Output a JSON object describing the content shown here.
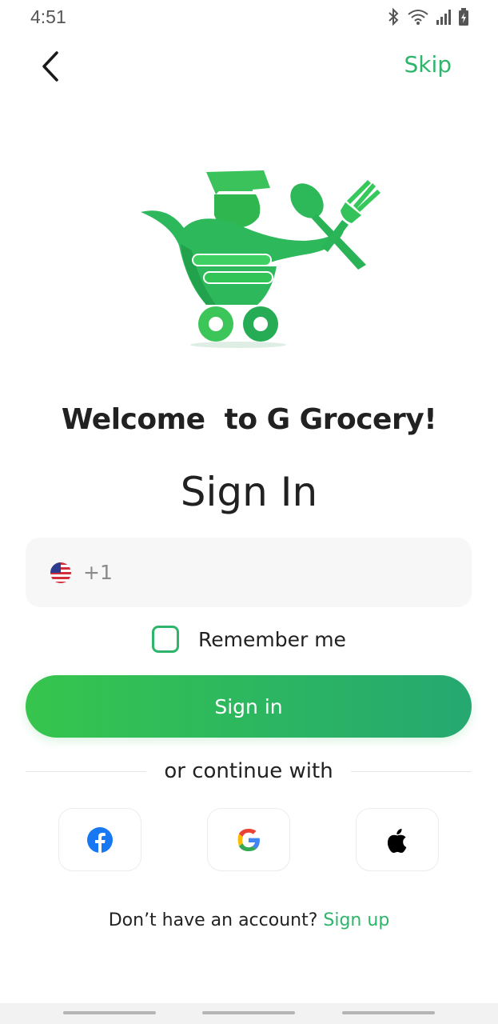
{
  "status_bar": {
    "time": "4:51",
    "icons": [
      "bluetooth-icon",
      "wifi-icon",
      "signal-icon",
      "battery-charging-icon"
    ]
  },
  "header": {
    "back_icon": "chevron-left-icon",
    "skip_label": "Skip"
  },
  "logo": {
    "icon": "grocery-cart-logo",
    "colors": {
      "primary": "#2fb56b",
      "light": "#3dca5a",
      "dark": "#1f9a52"
    }
  },
  "welcome_text": "Welcome  to G Grocery!",
  "title": "Sign In",
  "phone_input": {
    "flag_icon": "us-flag-icon",
    "dial_code": "+1",
    "value": ""
  },
  "remember_me": {
    "label": "Remember me",
    "checked": false
  },
  "sign_in_button": {
    "label": "Sign in",
    "colors": [
      "#36c54d",
      "#26a871"
    ]
  },
  "divider": {
    "text": "or continue with"
  },
  "social_buttons": [
    {
      "name": "facebook",
      "icon": "facebook-icon",
      "color": "#1877f2"
    },
    {
      "name": "google",
      "icon": "google-icon",
      "colors": [
        "#4285f4",
        "#ea4335",
        "#fbbc05",
        "#34a853"
      ]
    },
    {
      "name": "apple",
      "icon": "apple-icon",
      "color": "#000000"
    }
  ],
  "footer": {
    "prompt": "Don’t have an account?",
    "signup_label": "Sign up"
  },
  "accent_color": "#2fb56b"
}
